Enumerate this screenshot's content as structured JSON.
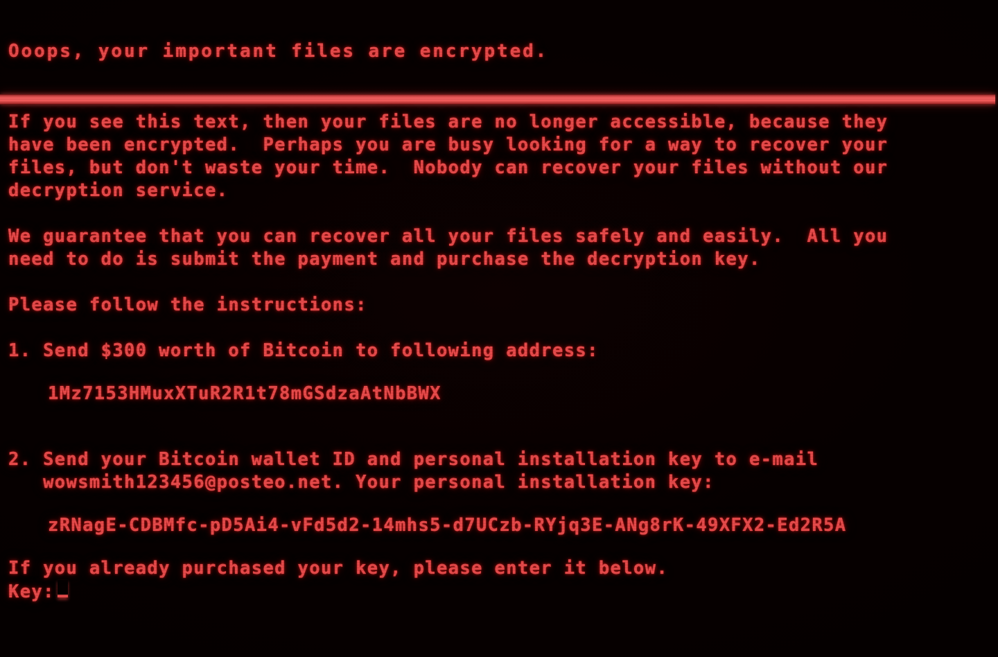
{
  "screen": {
    "background_color": "#040000",
    "text_color": "#e64a4a",
    "divider_color": "#f2605f",
    "headline": "Ooops, your important files are encrypted."
  },
  "body": {
    "paragraph_1_lines": [
      "If you see this text, then your files are no longer accessible, because they",
      "have been encrypted.  Perhaps you are busy looking for a way to recover your",
      "files, but don't waste your time.  Nobody can recover your files without our",
      "decryption service."
    ],
    "paragraph_2_lines": [
      "We guarantee that you can recover all your files safely and easily.  All you",
      "need to do is submit the payment and purchase the decryption key."
    ],
    "instructions_heading": "Please follow the instructions:",
    "step_1_line": "1. Send $300 worth of Bitcoin to following address:",
    "bitcoin_address": "1Mz7153HMuxXTuR2R1t78mGSdzaAtNbBWX",
    "step_2_lines": [
      "2. Send your Bitcoin wallet ID and personal installation key to e-mail",
      "   wowsmith123456@posteo.net. Your personal installation key:"
    ],
    "installation_key": "zRNagE-CDBMfc-pD5Ai4-vFd5d2-14mhs5-d7UCzb-RYjq3E-ANg8rK-49XFX2-Ed2R5A",
    "purchased_prompt": "If you already purchased your key, please enter it below.",
    "key_label": "Key:",
    "key_value": ""
  }
}
